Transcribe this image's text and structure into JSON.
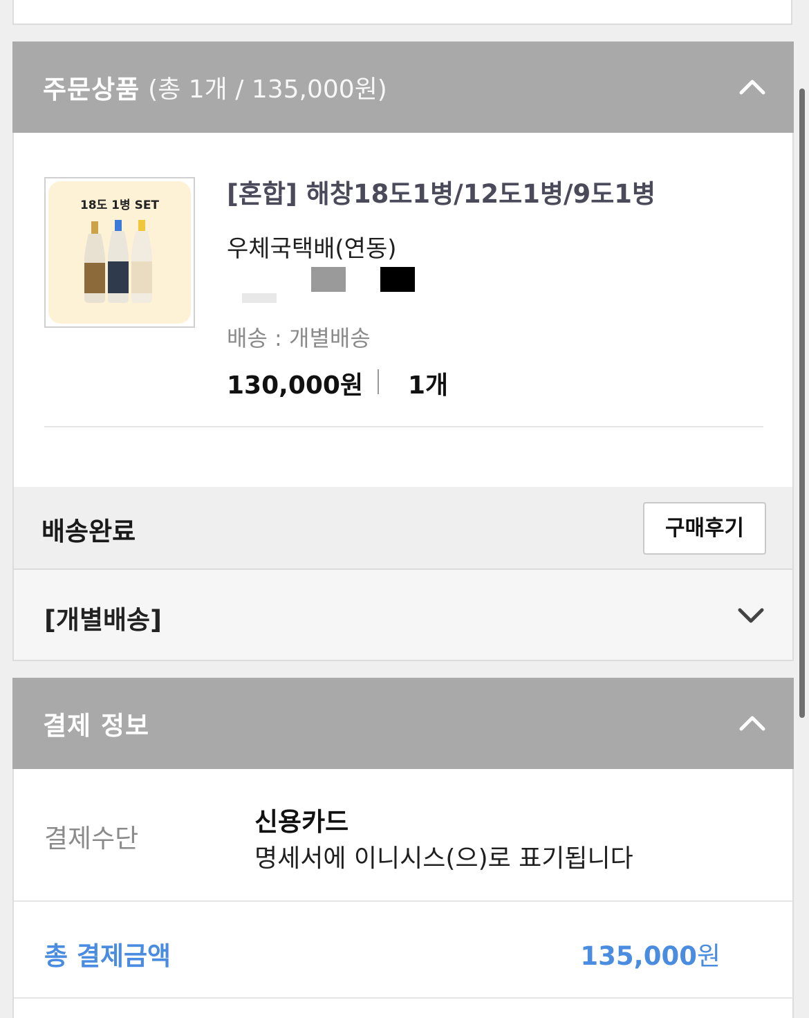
{
  "order_items": {
    "title": "주문상품",
    "summary": "(총 1개 / 135,000원)",
    "product": {
      "thumbnail_label": "18도 1병 SET",
      "name": "[혼합] 해창18도1병/12도1병/9도1병",
      "shipping_company": "우체국택배(연동)",
      "delivery_mode": "배송 : 개별배송",
      "price": "130,000원",
      "quantity": "1개"
    },
    "status": "배송완료",
    "review_button": "구매후기",
    "individual_shipping": "[개별배송]"
  },
  "payment_info": {
    "title": "결제 정보",
    "method_label": "결제수단",
    "method_value": "신용카드",
    "method_note": "명세서에 이니시스(으)로 표기됩니다",
    "total_label": "총 결제금액",
    "total_amount": "135,000",
    "total_unit": "원"
  },
  "colors": {
    "header_bg": "#a9a9a9",
    "accent_blue": "#4a8ce0"
  }
}
